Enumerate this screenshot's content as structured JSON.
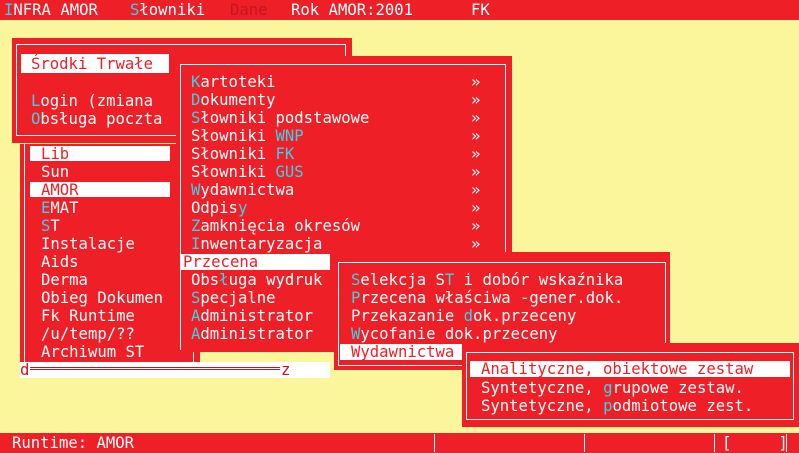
{
  "menubar": {
    "items": [
      {
        "hotkey": "I",
        "rest": "NFRA AMOR"
      },
      {
        "hotkey": "S",
        "rest": "łowniki"
      },
      {
        "label": "Dane"
      },
      {
        "label": "Rok AMOR:2001"
      },
      {
        "label": "FK"
      }
    ]
  },
  "system_window": {
    "title": "Środki Trwałe",
    "items": [
      {
        "hotkey": "L",
        "rest": "ogin (zmiana"
      },
      {
        "hotkey": "O",
        "rest": "bsługa poczta"
      }
    ]
  },
  "program_list": {
    "items": [
      "Lib",
      "Sun",
      "AMOR",
      "EMAT",
      "ST",
      "Instalacje",
      "Aids",
      "Derma",
      "Obieg Dokumen",
      "Fk Runtime",
      "/u/temp/??",
      "Archiwum ST"
    ],
    "hotkeys": {
      "EMAT": "E",
      "ST": "S"
    },
    "highlighted": [
      "Lib",
      "AMOR"
    ],
    "scroll_left": "d",
    "scroll_right": "z"
  },
  "main_menu": {
    "items": [
      {
        "hotkey": "K",
        "rest": "artoteki",
        "arrow": "»"
      },
      {
        "hotkey": "D",
        "rest": "okumenty",
        "arrow": "»"
      },
      {
        "hotkey": "S",
        "rest": "łowniki podstawowe",
        "arrow": "»"
      },
      {
        "pre": "Słowniki ",
        "hotkey": "WNP",
        "arrow": "»"
      },
      {
        "pre": "Słowniki ",
        "hotkey": "FK",
        "arrow": "»"
      },
      {
        "pre": "Słowniki ",
        "hotkey": "GUS",
        "arrow": "»"
      },
      {
        "hotkey": "W",
        "rest": "ydawnictwa",
        "arrow": "»"
      },
      {
        "pre": "Odpis",
        "hotkey": "y",
        "arrow": "»"
      },
      {
        "hotkey": "Z",
        "rest": "amknięcia okresów",
        "arrow": "»"
      },
      {
        "hotkey": "I",
        "rest": "nwentaryzacja",
        "arrow": "»"
      },
      {
        "label": "Przecena"
      },
      {
        "pre": "Obs",
        "hotkey": "ł",
        "rest": "uga wydruk"
      },
      {
        "hotkey": "S",
        "rest": "pecjalne"
      },
      {
        "hotkey": "A",
        "rest": "dministrator"
      },
      {
        "hotkey": "A",
        "rest": "dministrator"
      }
    ]
  },
  "przecena_menu": {
    "items": [
      {
        "hotkey": "S",
        "rest": "elekcja ST i dobór wskaźnika"
      },
      {
        "hotkey": "P",
        "rest": "rzecena właściwa -gener.dok."
      },
      {
        "pre": "Przekazanie ",
        "hotkey": "d",
        "rest": "okumentu"
      },
      {
        "hotkey": "W",
        "rest": "ycofanie dok.przeceny"
      },
      {
        "label": "Wydawnictwa"
      }
    ],
    "visible_text": {
      "row1": "Selekcja ST i dobór wskaźnika",
      "row2": "Przecena właściwa -gener.dok.",
      "row3": "Przekazanie dok.przeceny",
      "row4": "Wycofanie dok.przeceny",
      "row5": "Wydawnictwa"
    }
  },
  "wydawnictwa_menu": {
    "items": [
      "Analityczne, obiektowe zestaw",
      "Syntetyczne, grupowe zestaw.",
      "Syntetyczne, podmiotowe zest."
    ],
    "hotkeys": [
      "",
      "g",
      "p"
    ],
    "selected_index": 0
  },
  "statusbar": {
    "runtime": "Runtime: AMOR",
    "bracket": "[     ]"
  },
  "colors": {
    "background": "#fbf59c",
    "panel": "#ee1f26",
    "hotkey": "#3ad2ea",
    "text": "#ffffff"
  }
}
